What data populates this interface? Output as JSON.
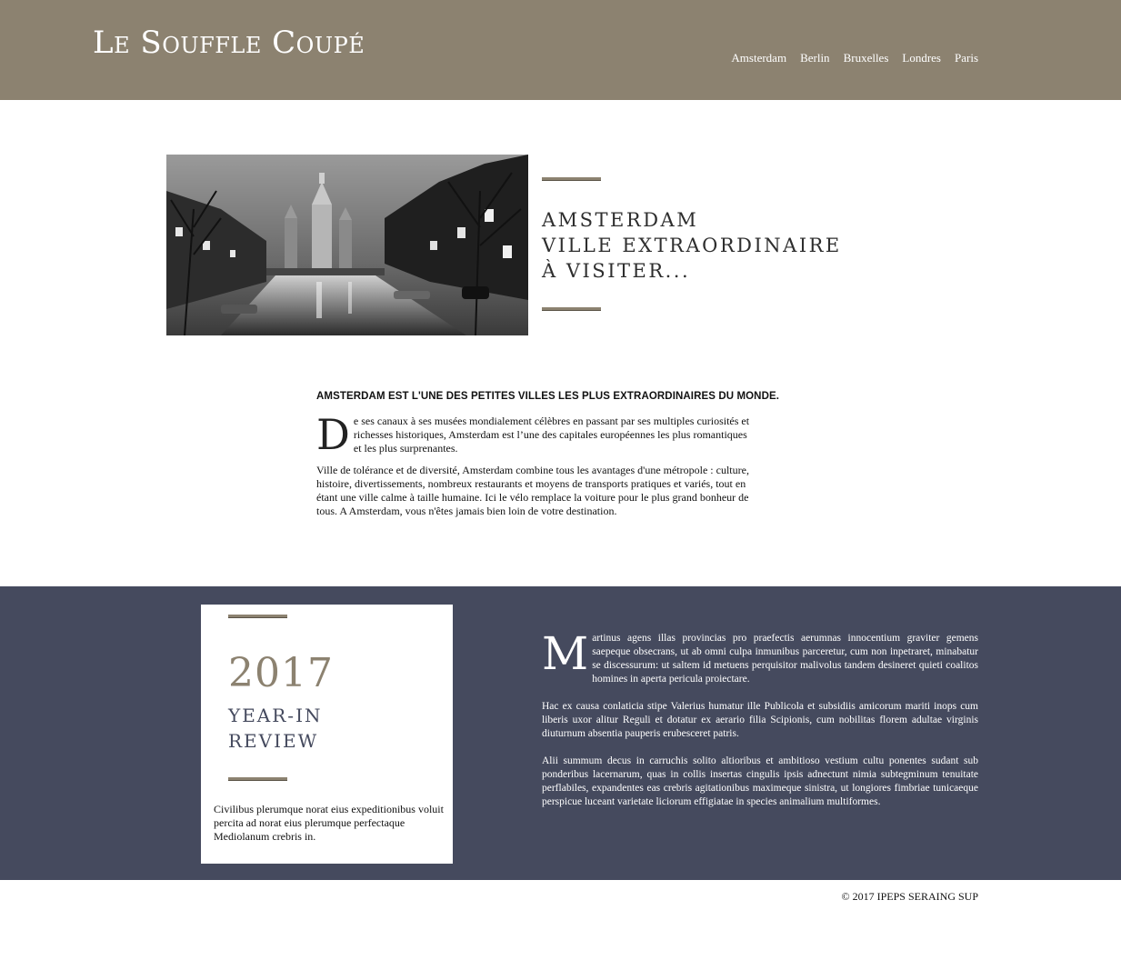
{
  "header": {
    "logo": "Le Souffle Coupé",
    "nav": [
      "Amsterdam",
      "Berlin",
      "Bruxelles",
      "Londres",
      "Paris"
    ]
  },
  "hero": {
    "title_lines": [
      "Amsterdam",
      "ville extraordinaire",
      "à visiter..."
    ]
  },
  "article": {
    "heading": "Amsterdam est l'une des petites villes les plus extraordinaires du monde.",
    "dropcap": "D",
    "p1": "e ses canaux à ses musées mondialement célèbres en passant par ses multiples curiosités et richesses historiques, Amsterdam est l’une des capitales européennes les plus romantiques et les plus surprenantes.",
    "p2": "Ville de tolérance et de diversité, Amsterdam combine tous les avantages d'une métropole : culture, histoire, divertissements, nombreux restaurants et moyens de transports pratiques et variés, tout en étant une ville calme à taille humaine. Ici le vélo remplace la voiture pour le plus grand bonheur de tous. A Amsterdam, vous n'êtes jamais bien loin de votre destination."
  },
  "review": {
    "year": "2017",
    "label_lines": [
      "Year-in",
      "Review"
    ],
    "text": "Civilibus plerumque norat eius expeditionibus voluit percita ad norat eius plerumque perfectaque Mediolanum crebris in."
  },
  "band": {
    "dropcap": "M",
    "p1": "artinus agens illas provincias pro praefectis aerumnas innocentium graviter gemens saepeque obsecrans, ut ab omni culpa inmunibus parceretur, cum non inpetraret, minabatur se discessurum: ut saltem id metuens perquisitor malivolus tandem desineret quieti coalitos homines in aperta pericula proiectare.",
    "p2": "Hac ex causa conlaticia stipe Valerius humatur ille Publicola et subsidiis amicorum mariti inops cum liberis uxor alitur Reguli et dotatur ex aerario filia Scipionis, cum nobilitas florem adultae virginis diuturnum absentia pauperis erubesceret patris.",
    "p3": "Alii summum decus in carruchis solito altioribus et ambitioso vestium cultu ponentes sudant sub ponderibus lacernarum, quas in collis insertas cingulis ipsis adnectunt nimia subtegminum tenuitate perflabiles, expandentes eas crebris agitationibus maximeque sinistra, ut longiores fimbriae tunicaeque perspicue luceant varietate liciorum effigiatae in species animalium multiformes."
  },
  "footer": {
    "copyright": "© 2017 IPEPS SERAING SUP"
  },
  "colors": {
    "header_bg": "#8c8270",
    "band_bg": "#454a5e",
    "accent": "#8c8270"
  }
}
